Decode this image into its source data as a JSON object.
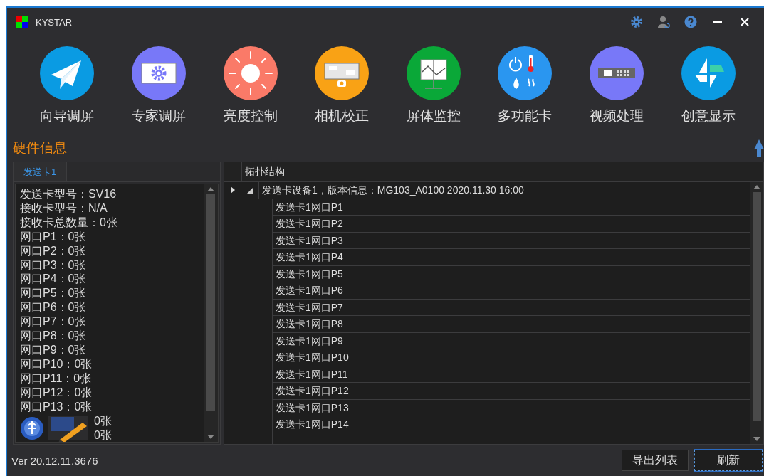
{
  "window": {
    "title": "KYSTAR"
  },
  "toolbar": [
    {
      "label": "向导调屏",
      "kind": "plane",
      "color": "#0a9be3"
    },
    {
      "label": "专家调屏",
      "kind": "screen-gear",
      "color": "#7878f8"
    },
    {
      "label": "亮度控制",
      "kind": "sun",
      "color": "#fa7a68"
    },
    {
      "label": "相机校正",
      "kind": "camera",
      "color": "#f9a215"
    },
    {
      "label": "屏体监控",
      "kind": "monitor",
      "color": "#0aa838"
    },
    {
      "label": "多功能卡",
      "kind": "sensors",
      "color": "#2a96f0"
    },
    {
      "label": "视频处理",
      "kind": "video",
      "color": "#7878f8"
    },
    {
      "label": "创意显示",
      "kind": "pinwheel",
      "color": "#0a9be3"
    }
  ],
  "section_title": "硬件信息",
  "info_panel": {
    "tabs": [
      {
        "label": "发送卡1",
        "selected": true
      }
    ],
    "lines": [
      "发送卡型号：SV16",
      "接收卡型号：N/A",
      "接收卡总数量：0张",
      "网口P1：0张",
      "网口P2：0张",
      "网口P3：0张",
      "网口P4：0张",
      "网口P5：0张",
      "网口P6：0张",
      "网口P7：0张",
      "网口P8：0张",
      "网口P9：0张",
      "网口P10：0张",
      "网口P11：0张",
      "网口P12：0张",
      "网口P13：0张"
    ],
    "covered_lines": [
      "0张",
      "0张"
    ]
  },
  "topology": {
    "header": "拓扑结构",
    "root": {
      "label": "发送卡设备1，版本信息：MG103_A0100 2020.11.30 16:00",
      "expanded": true,
      "current": true,
      "children": [
        {
          "label": "发送卡1网口P1"
        },
        {
          "label": "发送卡1网口P2"
        },
        {
          "label": "发送卡1网口P3"
        },
        {
          "label": "发送卡1网口P4"
        },
        {
          "label": "发送卡1网口P5"
        },
        {
          "label": "发送卡1网口P6"
        },
        {
          "label": "发送卡1网口P7"
        },
        {
          "label": "发送卡1网口P8"
        },
        {
          "label": "发送卡1网口P9"
        },
        {
          "label": "发送卡1网口P10"
        },
        {
          "label": "发送卡1网口P11"
        },
        {
          "label": "发送卡1网口P12"
        },
        {
          "label": "发送卡1网口P13"
        },
        {
          "label": "发送卡1网口P14"
        }
      ]
    }
  },
  "status_bar": {
    "version": "Ver 20.12.11.3676"
  },
  "buttons": [
    {
      "label": "导出列表",
      "focused": false
    },
    {
      "label": "刷新",
      "focused": true
    }
  ]
}
